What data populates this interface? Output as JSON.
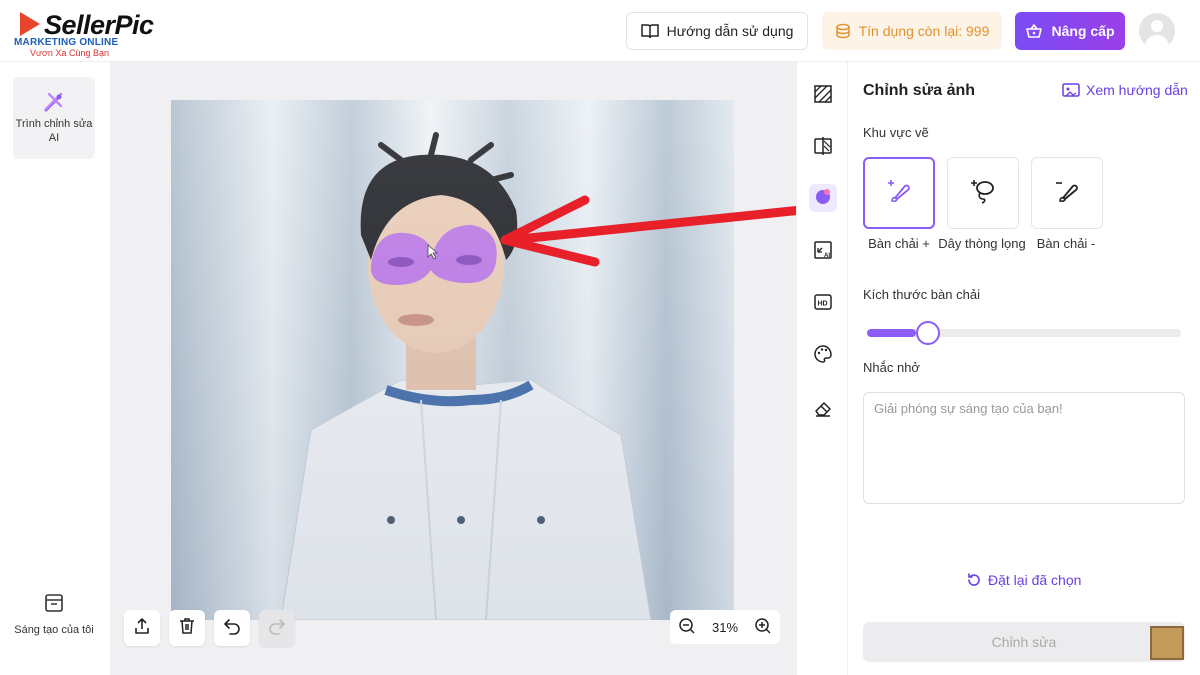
{
  "header": {
    "logo_text": "SellerPic",
    "watermark_line1": "MARKETING ONLINE",
    "watermark_line2": "Vươn Xa Cùng Bạn",
    "guide_label": "Hướng dẫn sử dụng",
    "credits_label": "Tín dụng còn lại: 999",
    "upgrade_label": "Nâng cấp"
  },
  "sidebar": {
    "tool_label": "Trình chỉnh sửa AI",
    "creations_label": "Sáng tạo của tôi"
  },
  "canvas": {
    "zoom": "31%"
  },
  "panel": {
    "title": "Chỉnh sửa ảnh",
    "guide_link": "Xem hướng dẫn",
    "area_label": "Khu vực vẽ",
    "options": [
      {
        "label": "Bàn chải +"
      },
      {
        "label": "Dây thòng lọng"
      },
      {
        "label": "Bàn chải -"
      }
    ],
    "brush_size_label": "Kích thước bàn chải",
    "brush_size_value": 0.13,
    "prompt_label": "Nhắc nhở",
    "prompt_placeholder": "Giải phóng sự sáng tạo của bạn!",
    "reset_label": "Đặt lại đã chọn",
    "edit_button": "Chỉnh sửa"
  },
  "colors": {
    "accent": "#8b5cf6",
    "mask": "#a855f7",
    "arrow": "#e8202a"
  }
}
